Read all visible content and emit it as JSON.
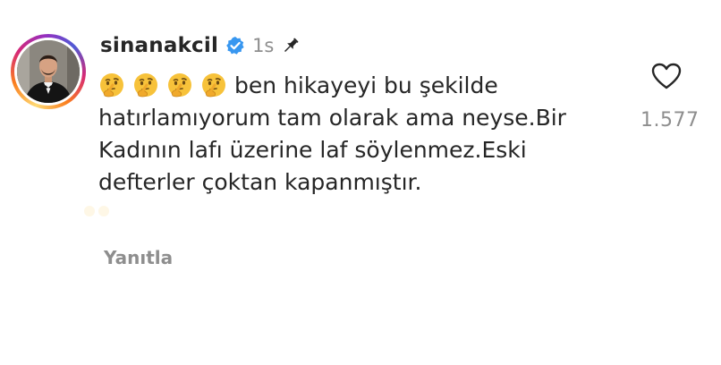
{
  "comment": {
    "username": "sinanakcil",
    "verified_icon": "verified-badge-icon",
    "time": "1s",
    "pin_icon": "pin-icon",
    "avatar_icon": "avatar",
    "emojis": [
      "thinking-face-icon",
      "thinking-face-icon",
      "thinking-face-icon",
      "thinking-face-icon"
    ],
    "text": "ben hikayeyi bu şekilde hatırlamıyorum tam olarak ama neyse.Bir Kadının lafı üzerine laf söylenmez.Eski defterler çoktan kapanmıştır.",
    "reply_label": "Yanıtla"
  },
  "likes": {
    "icon": "heart-icon",
    "count": "1.577"
  },
  "colors": {
    "text": "#262626",
    "muted": "#8e8e8e",
    "verified": "#3897f0",
    "emoji": "#f7c23a"
  }
}
